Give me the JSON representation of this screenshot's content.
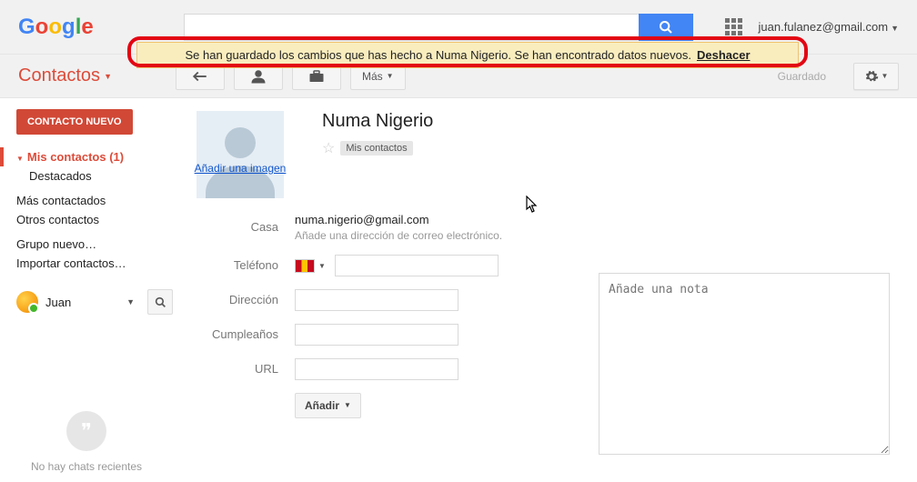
{
  "header": {
    "user_email": "juan.fulanez@gmail.com"
  },
  "notification": {
    "text": "Se han guardado los cambios que has hecho a Numa Nigerio. Se han encontrado datos nuevos.",
    "undo": "Deshacer"
  },
  "toolbar": {
    "app_title": "Contactos",
    "more_label": "Más",
    "saved_label": "Guardado"
  },
  "sidebar": {
    "new_contact": "CONTACTO NUEVO",
    "my_contacts": "Mis contactos (1)",
    "starred": "Destacados",
    "most_contacted": "Más contactados",
    "other_contacts": "Otros contactos",
    "new_group": "Grupo nuevo…",
    "import": "Importar contactos…",
    "user_name": "Juan",
    "no_chats": "No hay chats recientes"
  },
  "contact": {
    "name": "Numa Nigerio",
    "add_image": "Añadir una imagen",
    "group": "Mis contactos",
    "fields": {
      "home_label": "Casa",
      "email": "numa.nigerio@gmail.com",
      "email_hint": "Añade una dirección de correo electrónico.",
      "phone_label": "Teléfono",
      "address_label": "Dirección",
      "birthday_label": "Cumpleaños",
      "url_label": "URL",
      "add_button": "Añadir"
    },
    "note_placeholder": "Añade una nota"
  }
}
